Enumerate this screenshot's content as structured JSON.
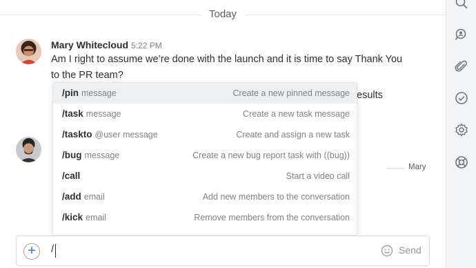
{
  "day_separator": "Today",
  "message": {
    "author": "Mary Whitecloud",
    "time": "5:22 PM",
    "text": "Am I right to assume we’re done with the launch and it is time to say Thank You to the PR team?",
    "partial_text": "esults"
  },
  "mary_tag": "Mary",
  "slash_commands": [
    {
      "cmd": "/pin",
      "arg": "message",
      "desc": "Create a new pinned message"
    },
    {
      "cmd": "/task",
      "arg": "message",
      "desc": "Create a new task message"
    },
    {
      "cmd": "/taskto",
      "arg": "@user message",
      "desc": "Create and assign a new task"
    },
    {
      "cmd": "/bug",
      "arg": "message",
      "desc": "Create a new bug report task with ((bug))"
    },
    {
      "cmd": "/call",
      "arg": "",
      "desc": "Start a video call"
    },
    {
      "cmd": "/add",
      "arg": "email",
      "desc": "Add new members to the conversation"
    },
    {
      "cmd": "/kick",
      "arg": "email",
      "desc": "Remove members from the conversation"
    }
  ],
  "composer": {
    "value": "/",
    "send_label": "Send"
  },
  "sidebar_icons": [
    "search-icon",
    "search-people-icon",
    "paperclip-icon",
    "check-circle-icon",
    "gear-icon",
    "lifebuoy-icon"
  ]
}
